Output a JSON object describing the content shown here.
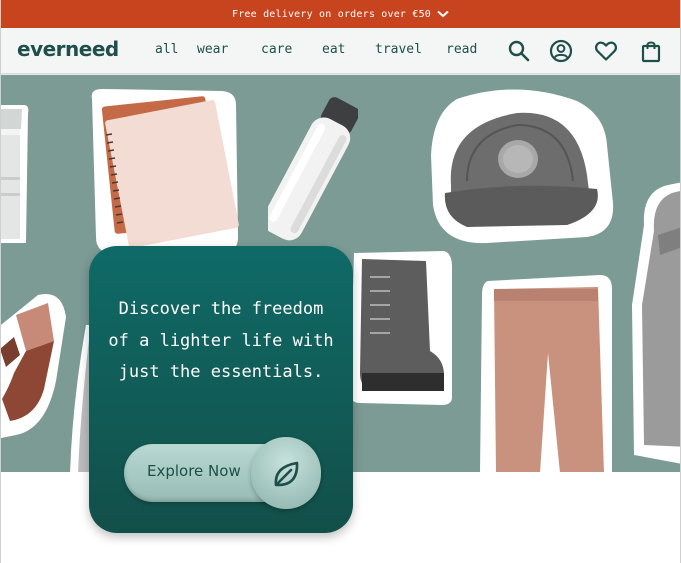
{
  "promo": {
    "text": "Free delivery on orders over €50"
  },
  "header": {
    "logo": "everneed",
    "nav": [
      "all",
      "wear",
      "care",
      "eat",
      "travel",
      "read"
    ]
  },
  "icons": {
    "search": "search-icon",
    "account": "user-circle-icon",
    "wishlist": "heart-icon",
    "cart": "shopping-bag-icon",
    "promo_chevron": "chevron-down-icon",
    "leaf": "leaf-icon"
  },
  "hero": {
    "headline": "Discover the freedom of a lighter life with just the essentials.",
    "cta_label": "Explore Now"
  },
  "colors": {
    "promo_bg": "#c8441f",
    "brand": "#1f4f4a",
    "hero_bg": "#7c9b95",
    "card_top": "#0f6a67",
    "card_bottom": "#134f49",
    "button": "#a9cbc4"
  }
}
